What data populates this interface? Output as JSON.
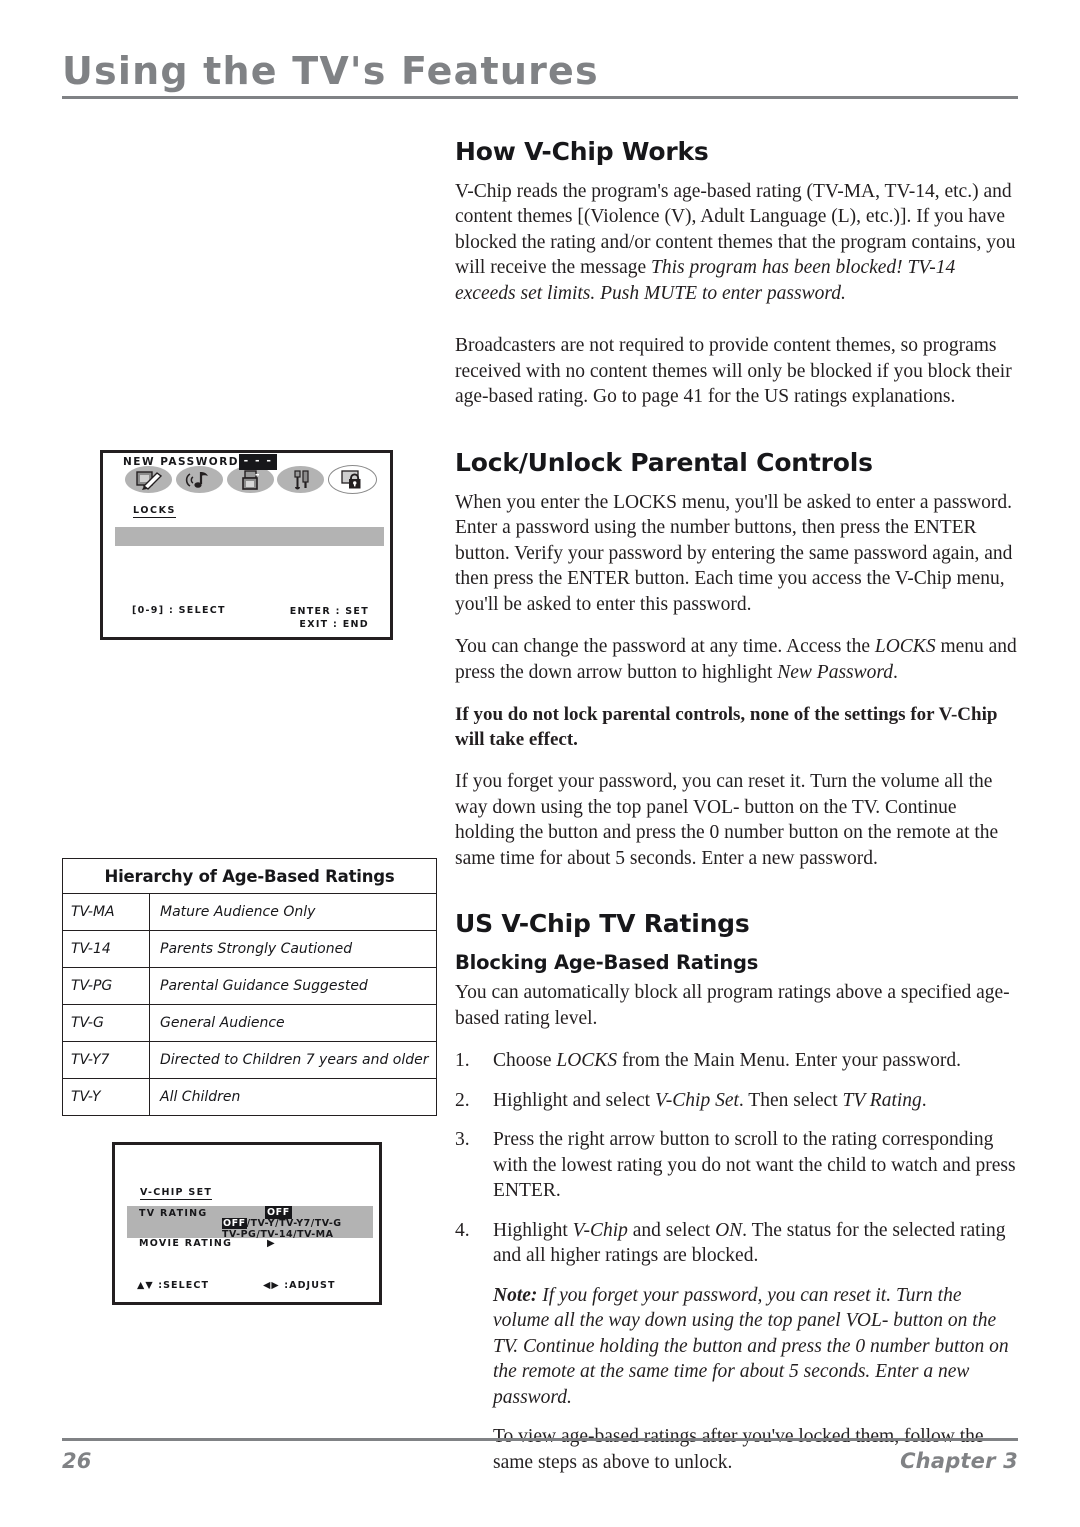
{
  "page": {
    "title": "Using the TV's Features",
    "number": "26",
    "chapter": "Chapter 3"
  },
  "sections": {
    "how_vchip": {
      "heading": "How V-Chip Works",
      "p1_a": "V-Chip reads the program's age-based rating (TV-MA, TV-14, etc.) and content themes [(Violence (V), Adult Language (L), etc.)]. If you have blocked the rating and/or content themes that the program contains, you will receive the message ",
      "p1_italic": "This program has been blocked! TV-14 exceeds set limits. Push MUTE to enter password.",
      "p2": "Broadcasters are not required to provide content themes, so programs received with no content themes will only be blocked if you block their age-based rating. Go to page 41 for the US ratings explanations."
    },
    "lock_unlock": {
      "heading": "Lock/Unlock Parental Controls",
      "p1": "When you enter the LOCKS menu, you'll be asked to enter a password. Enter a password using the number buttons, then press the ENTER button. Verify your password by entering the same password again, and then press the ENTER button. Each time you access the V-Chip menu, you'll be asked to enter this password.",
      "p2_a": "You can change the password at any time. Access the ",
      "p2_ital1": "LOCKS",
      "p2_b": " menu and press the down arrow button to highlight ",
      "p2_ital2": "New Password",
      "p2_c": ".",
      "p3_bold": "If you do not lock parental controls, none of the settings for V-Chip will take effect.",
      "p4": "If you forget your password, you can reset it. Turn the volume all the way down using the top panel VOL- button on the TV. Continue holding the button and press the 0 number button on the remote at the same time for about 5 seconds. Enter a new password."
    },
    "us_ratings": {
      "heading": "US V-Chip TV Ratings",
      "sub_heading": "Blocking Age-Based Ratings",
      "intro": "You can automatically block all program ratings above a specified age-based rating level.",
      "steps": [
        {
          "num": "1.",
          "parts": [
            {
              "t": "Choose ",
              "style": "normal"
            },
            {
              "t": "LOCKS",
              "style": "italic"
            },
            {
              "t": " from the Main Menu. Enter your password.",
              "style": "normal"
            }
          ]
        },
        {
          "num": "2.",
          "parts": [
            {
              "t": "Highlight and select ",
              "style": "normal"
            },
            {
              "t": "V-Chip Set",
              "style": "italic"
            },
            {
              "t": ". Then select ",
              "style": "normal"
            },
            {
              "t": "TV Rating",
              "style": "italic"
            },
            {
              "t": ".",
              "style": "normal"
            }
          ]
        },
        {
          "num": "3.",
          "parts": [
            {
              "t": "Press the right arrow button to scroll to the rating corresponding with the lowest rating you do not want the child to watch and press ENTER.",
              "style": "normal"
            }
          ]
        },
        {
          "num": "4.",
          "parts": [
            {
              "t": "Highlight ",
              "style": "normal"
            },
            {
              "t": "V-Chip",
              "style": "italic"
            },
            {
              "t": " and select ",
              "style": "normal"
            },
            {
              "t": "ON",
              "style": "italic"
            },
            {
              "t": ". The status for the selected rating and all higher ratings are blocked.",
              "style": "normal"
            }
          ]
        }
      ],
      "note_label": "Note:",
      "note_text": " If you forget your password, you can reset it. Turn the volume all the way down using the top panel VOL- button on the TV. Continue holding the button and press the 0 number button on the remote at the same time for about 5 seconds. Enter a new password.",
      "closing": "To view age-based ratings after you've locked them, follow the same steps as above to unlock."
    }
  },
  "ratings_table": {
    "header": "Hierarchy of Age-Based Ratings",
    "rows": [
      {
        "code": "TV-MA",
        "desc": "Mature Audience Only"
      },
      {
        "code": "TV-14",
        "desc": "Parents Strongly Cautioned"
      },
      {
        "code": "TV-PG",
        "desc": "Parental Guidance Suggested"
      },
      {
        "code": "TV-G",
        "desc": "General Audience"
      },
      {
        "code": "TV-Y7",
        "desc": "Directed to Children 7 years and older"
      },
      {
        "code": "TV-Y",
        "desc": "All Children"
      }
    ]
  },
  "locks_osd": {
    "icons": [
      {
        "name": "picture-icon",
        "selected": false
      },
      {
        "name": "audio-icon",
        "selected": false
      },
      {
        "name": "channel-icon",
        "selected": false
      },
      {
        "name": "setup-icon",
        "selected": false
      },
      {
        "name": "locks-icon",
        "selected": true
      }
    ],
    "menu_label": "LOCKS",
    "row_label": "NEW PASSWORD",
    "row_value": "- - - -",
    "foot_left": "[0-9] : SELECT",
    "foot_right_1": "ENTER : SET",
    "foot_right_2": "EXIT : END"
  },
  "vchip_osd": {
    "menu_label": "V-CHIP SET",
    "tv_rating_label": "TV RATING",
    "tv_rating_value": "OFF",
    "options_line1_hl": "OFF",
    "options_line1_rest": "/TV-Y/TV-Y7/TV-G",
    "options_line2": "TV-PG/TV-14/TV-MA",
    "movie_rating_label": "MOVIE RATING",
    "movie_rating_arrow": "▶",
    "foot_left": "▲▼ :SELECT",
    "foot_right": "◀▶ :ADJUST"
  },
  "colors": {
    "title_gray": "#808285",
    "ink": "#231f20",
    "osd_gray": "#b3b3b3"
  }
}
